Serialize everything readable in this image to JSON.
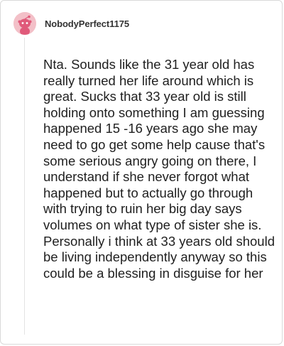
{
  "comment": {
    "username": "NobodyPerfect1175",
    "avatar_icon": "reddit-snoo-avatar-icon",
    "avatar_color": "#f3c0c8",
    "body": "Nta. Sounds like the 31 year old has really turned her life around which is great. Sucks that 33 year old is still holding onto something I am guessing happened 15 -16 years ago she may need to go get some help cause that's some serious angry going on there, I understand if she never forgot what happened but to actually go through with trying to ruin her big day says volumes on what type of sister she is. Personally i think at 33 years old should be living independently anyway so this could be a blessing in disguise for her"
  }
}
